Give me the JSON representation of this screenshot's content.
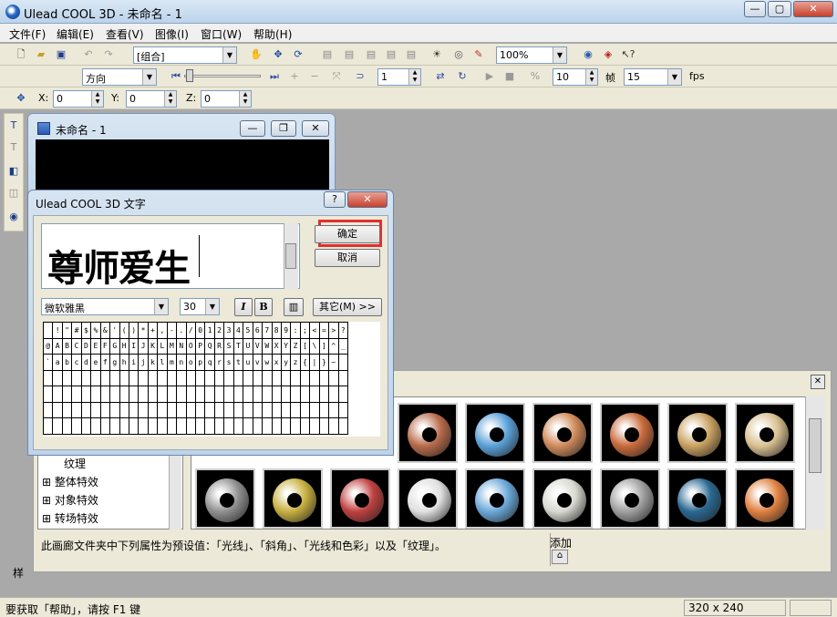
{
  "window": {
    "title": "Ulead COOL 3D - 未命名 - 1"
  },
  "menu": [
    "文件(F)",
    "编辑(E)",
    "查看(V)",
    "图像(I)",
    "窗口(W)",
    "帮助(H)"
  ],
  "toolbar1": {
    "combo_group": "[组合]",
    "zoom": "100%"
  },
  "toolbar2": {
    "direction": "方向",
    "frame_value": "1",
    "frame_count": "10",
    "frame_label": "帧",
    "fps_value": "15",
    "fps_label": "fps"
  },
  "toolbar3": {
    "x_label": "X:",
    "x_value": "0",
    "y_label": "Y:",
    "y_value": "0",
    "z_label": "Z:",
    "z_value": "0"
  },
  "doc_window": {
    "title": "未命名 - 1"
  },
  "text_dialog": {
    "title": "Ulead COOL 3D 文字",
    "text": "尊师爱生",
    "ok_label": "确定",
    "cancel_label": "取消",
    "font": "微软雅黑",
    "size": "30",
    "italic": "I",
    "bold": "B",
    "other_label": "其它(M) >>",
    "char_rows": [
      [
        " ",
        "!",
        "\"",
        "#",
        "$",
        "%",
        "&",
        "'",
        "(",
        ")",
        "*",
        "+",
        ",",
        "-",
        ".",
        "/",
        "0",
        "1",
        "2",
        "3",
        "4",
        "5",
        "6",
        "7",
        "8",
        "9",
        ":",
        ";",
        "<",
        "=",
        ">",
        "?"
      ],
      [
        "@",
        "A",
        "B",
        "C",
        "D",
        "E",
        "F",
        "G",
        "H",
        "I",
        "J",
        "K",
        "L",
        "M",
        "N",
        "O",
        "P",
        "Q",
        "R",
        "S",
        "T",
        "U",
        "V",
        "W",
        "X",
        "Y",
        "Z",
        "[",
        "\\",
        "]",
        "^",
        "_"
      ],
      [
        "`",
        "a",
        "b",
        "c",
        "d",
        "e",
        "f",
        "g",
        "h",
        "i",
        "j",
        "k",
        "l",
        "m",
        "n",
        "o",
        "p",
        "q",
        "r",
        "s",
        "t",
        "u",
        "v",
        "w",
        "x",
        "y",
        "z",
        "{",
        "|",
        "}",
        "~",
        ""
      ]
    ]
  },
  "library_panel": {
    "tree_items": [
      "纹理",
      "整体特效",
      "对象特效",
      "转场特效"
    ],
    "description": "此画廊文件夹中下列属性为预设值：「光线」、「斜角」、「光线和色彩」以及「纹理」。",
    "add_label": "添加",
    "ring_colors_top": [
      "#b86b4a",
      "#5aa0d8",
      "#d08a5a",
      "#c86a3a",
      "#c8a060",
      "#d8c090"
    ],
    "ring_colors_bottom": [
      "#909090",
      "#c8b040",
      "#c04040",
      "#e0e0e0",
      "#6aa8d8",
      "#d8d8d0",
      "#a0a0a0",
      "#2a6890",
      "#e08040"
    ],
    "side_label": "样"
  },
  "status": {
    "help_text": "要获取「帮助」，请按 F1 键",
    "dimensions": "320 x 240"
  }
}
